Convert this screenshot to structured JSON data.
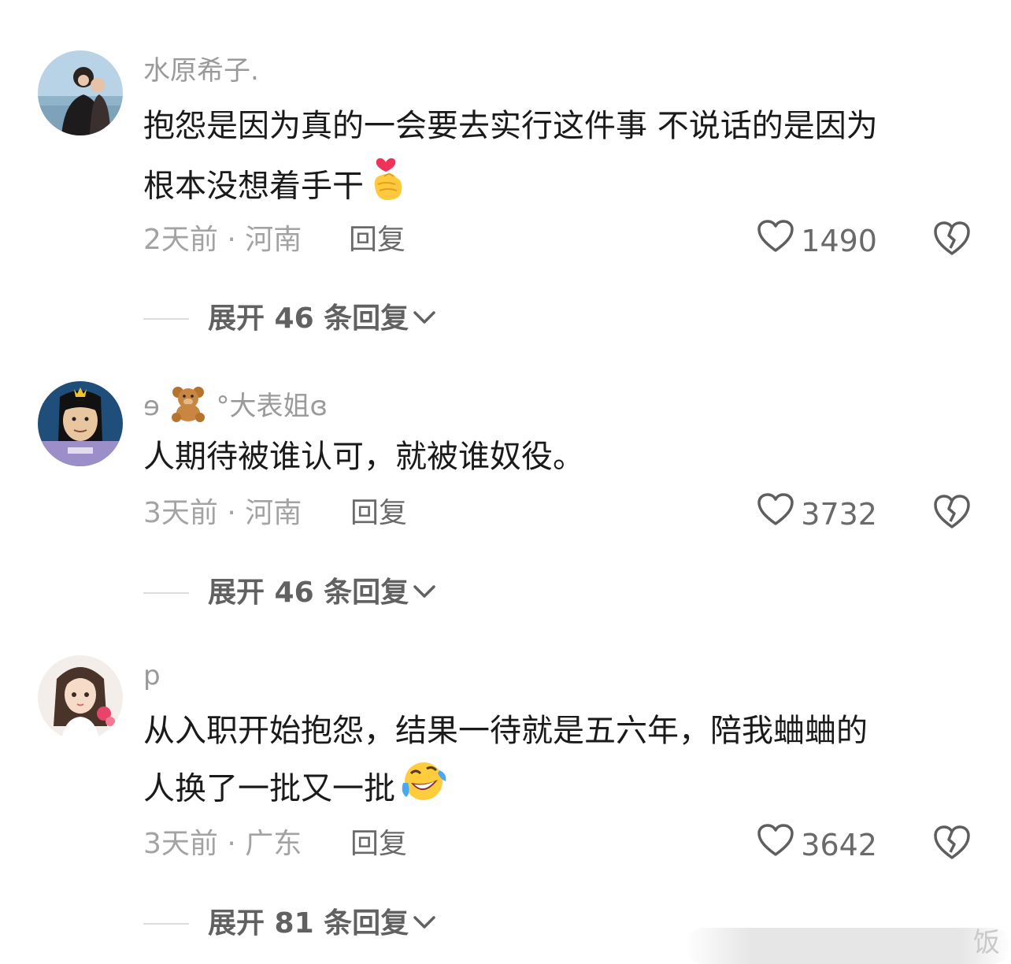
{
  "comments": [
    {
      "username": "水原希子.",
      "text_line1": "抱怨是因为真的一会要去实行这件事  不说话的是因为",
      "text_line2": "根本没想着手干",
      "emoji": "finger-heart-emoji",
      "meta": "2天前 · 河南",
      "reply_label": "回复",
      "likes": "1490",
      "expand_label": "展开 46 条回复"
    },
    {
      "username_prefix": "ɘ",
      "username_emoji": "teddy-bear-emoji",
      "username": "°大表姐ɞ",
      "text_line1": "人期待被谁认可，就被谁奴役。",
      "meta": "3天前 · 河南",
      "reply_label": "回复",
      "likes": "3732",
      "expand_label": "展开 46 条回复"
    },
    {
      "username": "p",
      "text_line1": "从入职开始抱怨，结果一待就是五六年，陪我蛐蛐的",
      "text_line2": "人换了一批又一批",
      "emoji": "laughing-tears-emoji",
      "meta": "3天前 · 广东",
      "reply_label": "回复",
      "likes": "3642",
      "expand_label": "展开 81 条回复"
    }
  ],
  "watermark": "饭",
  "colors": {
    "text": "#1a1a1a",
    "muted": "#a3a3a3",
    "action": "#6a6a6a"
  }
}
